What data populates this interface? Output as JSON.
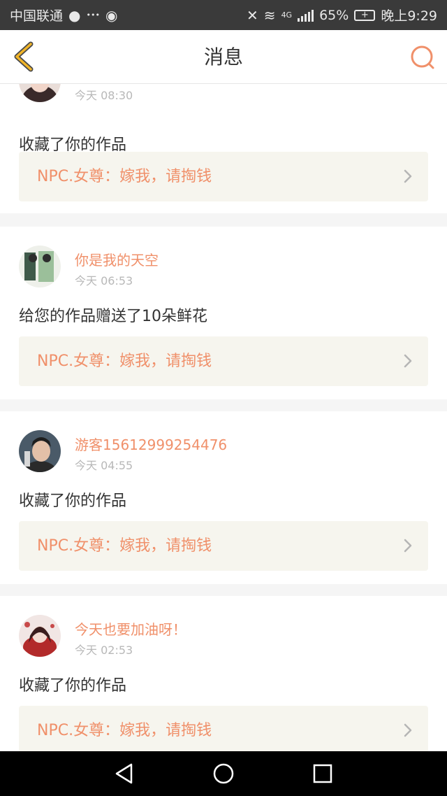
{
  "status_bar": {
    "carrier": "中国联通",
    "network": "4G",
    "battery": "65%",
    "time": "晚上9:29"
  },
  "header": {
    "title": "消息"
  },
  "colors": {
    "accent": "#f0906a",
    "back_icon": "#f0b428",
    "work_bg": "#f6f5ee"
  },
  "messages": [
    {
      "username": "",
      "time": "今天 08:30",
      "action": "收藏了你的作品",
      "work_title": "NPC.女尊：嫁我，请掏钱"
    },
    {
      "username": "你是我的天空",
      "time": "今天 06:53",
      "action": "给您的作品赠送了10朵鲜花",
      "work_title": "NPC.女尊：嫁我，请掏钱"
    },
    {
      "username": "游客15612999254476",
      "time": "今天 04:55",
      "action": "收藏了你的作品",
      "work_title": "NPC.女尊：嫁我，请掏钱"
    },
    {
      "username": "今天也要加油呀！",
      "time": "今天 02:53",
      "action": "收藏了你的作品",
      "work_title": "NPC.女尊：嫁我，请掏钱"
    }
  ]
}
